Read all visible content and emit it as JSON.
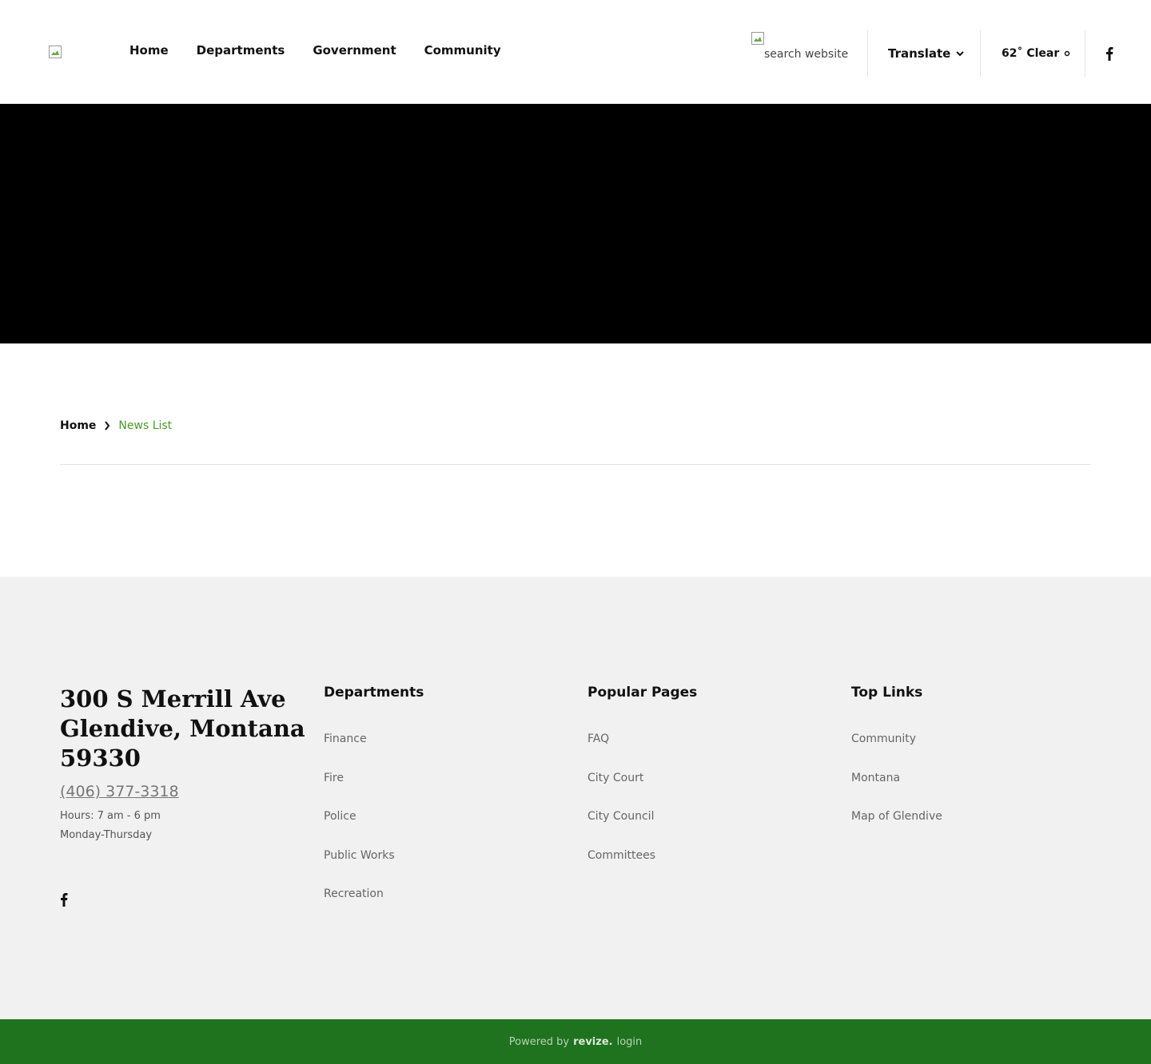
{
  "header": {
    "nav": [
      "Home",
      "Departments",
      "Government",
      "Community"
    ],
    "search_placeholder": "search website",
    "translate_label": "Translate",
    "weather_label": "62˚ Clear",
    "icons": {
      "facebook": "facebook-icon",
      "translate_chevron": "chevron-down-icon",
      "weather": "weather-icon",
      "logo": "broken-image-icon"
    }
  },
  "breadcrumb": {
    "home": "Home",
    "current": "News List"
  },
  "footer": {
    "address": "300 S Merrill Ave Glendive, Montana 59330",
    "phone": "(406) 377-3318",
    "hours_line1": "Hours: 7 am - 6 pm",
    "hours_line2": "Monday-Thursday",
    "departments": {
      "title": "Departments",
      "links": [
        "Finance",
        "Fire",
        "Police",
        "Public Works",
        "Recreation"
      ]
    },
    "popular": {
      "title": "Popular Pages",
      "links": [
        "FAQ",
        "City Court",
        "City Council",
        "Committees"
      ]
    },
    "top": {
      "title": "Top Links",
      "links": [
        "Community",
        "Montana",
        "Map of Glendive"
      ]
    }
  },
  "bottom": {
    "powered_by": "Powered by",
    "brand": "revize.",
    "login": "login"
  },
  "colors": {
    "accent_green": "#4a9a2c",
    "footer_bar": "#1f721e"
  }
}
